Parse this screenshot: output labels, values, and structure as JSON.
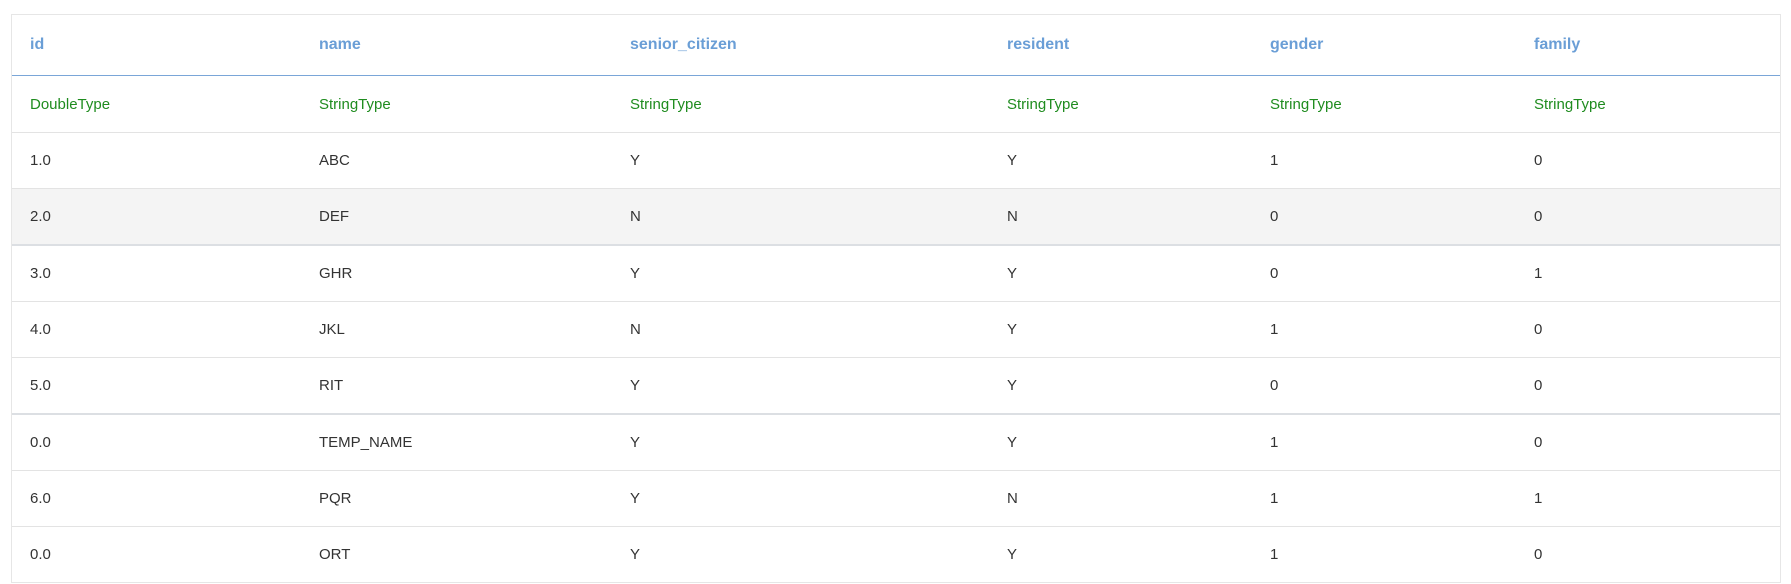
{
  "colors": {
    "header_text": "#6a9ed6",
    "type_text": "#1f8c1f",
    "cell_text": "#333333",
    "hover_row": "#f4f4f4"
  },
  "table": {
    "columns": [
      "id",
      "name",
      "senior_citizen",
      "resident",
      "gender",
      "family"
    ],
    "types": [
      "DoubleType",
      "StringType",
      "StringType",
      "StringType",
      "StringType",
      "StringType"
    ],
    "rows": [
      [
        "1.0",
        "ABC",
        "Y",
        "Y",
        "1",
        "0"
      ],
      [
        "2.0",
        "DEF",
        "N",
        "N",
        "0",
        "0"
      ],
      [
        "3.0",
        "GHR",
        "Y",
        "Y",
        "0",
        "1"
      ],
      [
        "4.0",
        "JKL",
        "N",
        "Y",
        "1",
        "0"
      ],
      [
        "5.0",
        "RIT",
        "Y",
        "Y",
        "0",
        "0"
      ],
      [
        "0.0",
        "TEMP_NAME",
        "Y",
        "Y",
        "1",
        "0"
      ],
      [
        "6.0",
        "PQR",
        "Y",
        "N",
        "1",
        "1"
      ],
      [
        "0.0",
        "ORT",
        "Y",
        "Y",
        "1",
        "0"
      ]
    ]
  }
}
